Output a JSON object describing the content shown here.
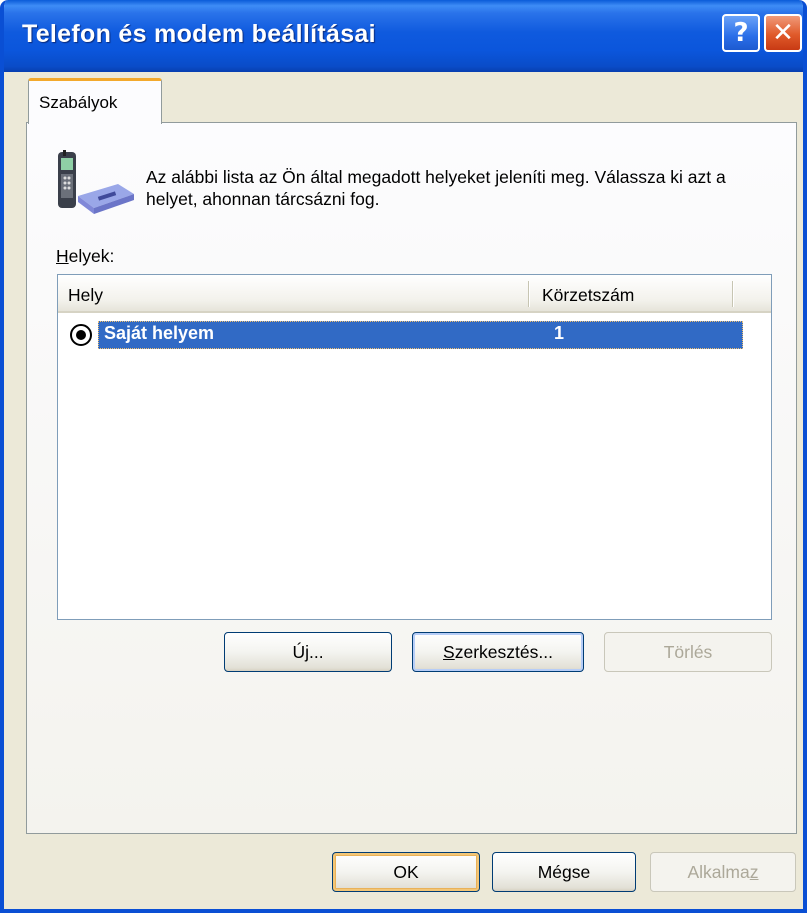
{
  "window": {
    "title": "Telefon és modem beállításai",
    "help_glyph": "?",
    "close_glyph": "✕"
  },
  "tabs": [
    {
      "label": "Szabályok",
      "selected": true
    }
  ],
  "intro": {
    "text": "Az alábbi lista az Ön által megadott helyeket jeleníti meg. Válassza ki azt a helyet, ahonnan tárcsázni fog."
  },
  "places": {
    "label_mnemonic": "H",
    "label_rest": "elyek:",
    "columns": [
      "Hely",
      "Körzetszám"
    ],
    "rows": [
      {
        "name": "Saját helyem",
        "area_code": "1",
        "selected": true
      }
    ]
  },
  "list_buttons": {
    "new_label": "Új...",
    "edit_mnemonic": "S",
    "edit_rest": "zerkesztés...",
    "delete_label": "Törlés"
  },
  "dialog_buttons": {
    "ok_label": "OK",
    "cancel_label": "Mégse",
    "apply_main": "Alkalma",
    "apply_mnemonic": "z"
  },
  "colors": {
    "titlebar": "#0a56dc",
    "selection": "#316ac5",
    "tab_highlight": "#f3a92c",
    "dialog_bg": "#ece9d8"
  }
}
